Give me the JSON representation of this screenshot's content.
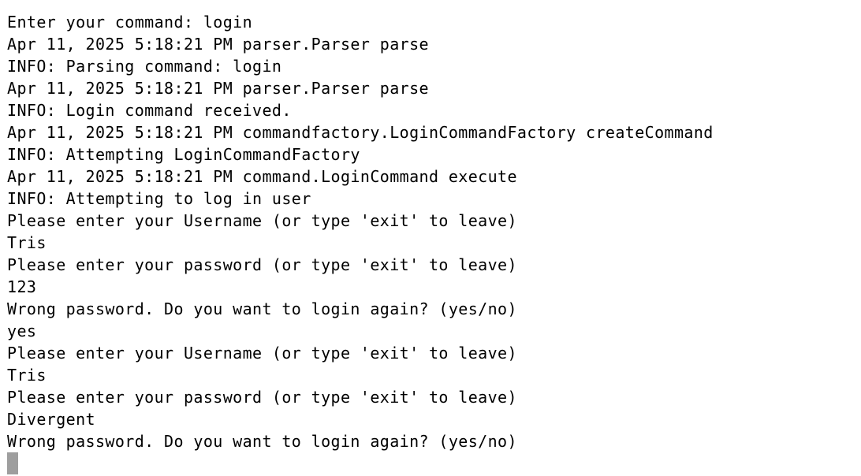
{
  "terminal": {
    "lines": [
      "Enter your command: login",
      "Apr 11, 2025 5:18:21 PM parser.Parser parse",
      "INFO: Parsing command: login",
      "Apr 11, 2025 5:18:21 PM parser.Parser parse",
      "INFO: Login command received.",
      "Apr 11, 2025 5:18:21 PM commandfactory.LoginCommandFactory createCommand",
      "INFO: Attempting LoginCommandFactory",
      "Apr 11, 2025 5:18:21 PM command.LoginCommand execute",
      "INFO: Attempting to log in user",
      "Please enter your Username (or type 'exit' to leave)",
      "Tris",
      "Please enter your password (or type 'exit' to leave)",
      "123",
      "Wrong password. Do you want to login again? (yes/no)",
      "yes",
      "Please enter your Username (or type 'exit' to leave)",
      "Tris",
      "Please enter your password (or type 'exit' to leave)",
      "Divergent",
      "Wrong password. Do you want to login again? (yes/no)"
    ],
    "cursor_color": "#9e9e9e",
    "text_color": "#000000",
    "background_color": "#ffffff"
  }
}
